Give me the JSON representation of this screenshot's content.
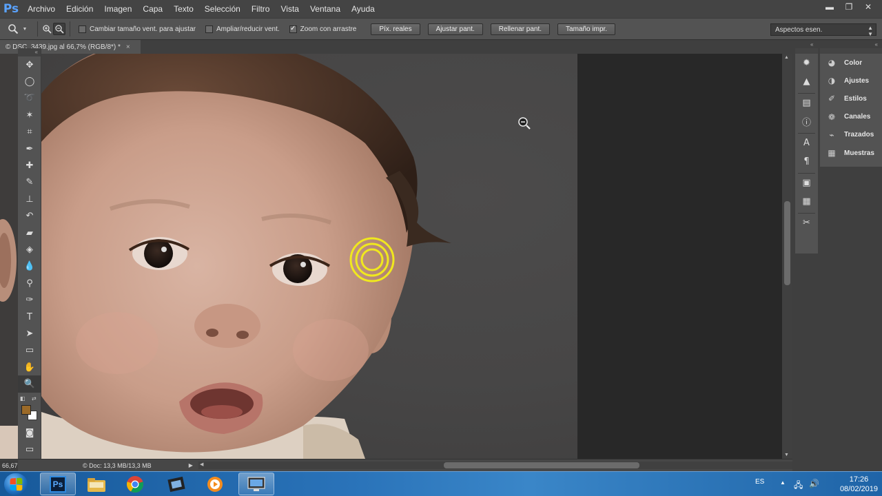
{
  "app": {
    "logo": "Ps"
  },
  "menu": [
    "Archivo",
    "Edición",
    "Imagen",
    "Capa",
    "Texto",
    "Selección",
    "Filtro",
    "Vista",
    "Ventana",
    "Ayuda"
  ],
  "window_controls": {
    "minimize": "▬",
    "restore": "❐",
    "close": "✕"
  },
  "options": {
    "tool_icon": "zoom-icon",
    "resize_windows_label": "Cambiar tamaño vent. para ajustar",
    "resize_windows_checked": false,
    "zoom_all_windows_label": "Ampliar/reducir vent.",
    "zoom_all_windows_checked": false,
    "scrubby_zoom_label": "Zoom con arrastre",
    "scrubby_zoom_checked": true,
    "check_mark": "✓",
    "buttons": [
      "Píx. reales",
      "Ajustar pant.",
      "Rellenar pant.",
      "Tamaño impr."
    ],
    "workspace": "Aspectos esen."
  },
  "document": {
    "tab_label": "© DSC_3439.jpg al 66,7% (RGB/8*) *",
    "tab_close": "×",
    "zoom": "66,67",
    "doc_info": "© Doc: 13,3 MB/13,3 MB",
    "status_arrow": "▶"
  },
  "toolbar": {
    "collapse": "«",
    "tools": [
      {
        "name": "move-tool",
        "glyph": "✥"
      },
      {
        "name": "elliptical-marquee-tool",
        "glyph": "◯"
      },
      {
        "name": "lasso-tool",
        "glyph": "➰"
      },
      {
        "name": "magic-wand-tool",
        "glyph": "✶"
      },
      {
        "name": "crop-tool",
        "glyph": "⌗"
      },
      {
        "name": "eyedropper-tool",
        "glyph": "✒"
      },
      {
        "name": "healing-brush-tool",
        "glyph": "✚"
      },
      {
        "name": "brush-tool",
        "glyph": "✎"
      },
      {
        "name": "clone-stamp-tool",
        "glyph": "⊥"
      },
      {
        "name": "history-brush-tool",
        "glyph": "↶"
      },
      {
        "name": "eraser-tool",
        "glyph": "▰"
      },
      {
        "name": "paint-bucket-tool",
        "glyph": "◈"
      },
      {
        "name": "blur-tool",
        "glyph": "💧"
      },
      {
        "name": "dodge-tool",
        "glyph": "⚲"
      },
      {
        "name": "pen-tool",
        "glyph": "✑"
      },
      {
        "name": "type-tool",
        "glyph": "T"
      },
      {
        "name": "path-selection-tool",
        "glyph": "➤"
      },
      {
        "name": "rectangle-tool",
        "glyph": "▭"
      },
      {
        "name": "hand-tool",
        "glyph": "✋"
      },
      {
        "name": "zoom-tool",
        "glyph": "🔍"
      }
    ],
    "selected": "zoom-tool",
    "foreground_color": "#9b6a28",
    "background_color": "#ffffff"
  },
  "panels": {
    "collapse": "«",
    "icons": [
      "navigator-icon",
      "histogram-icon",
      "layer-comps-icon",
      "info-icon",
      "character-icon",
      "paragraph-icon",
      "history-icon",
      "actions-icon",
      "tool-presets-icon"
    ],
    "items": [
      {
        "label": "Color",
        "icon": "color-palette-icon"
      },
      {
        "label": "Ajustes",
        "icon": "adjustments-icon"
      },
      {
        "label": "Estilos",
        "icon": "styles-icon"
      },
      {
        "label": "Canales",
        "icon": "channels-icon"
      },
      {
        "label": "Trazados",
        "icon": "paths-icon"
      },
      {
        "label": "Muestras",
        "icon": "swatches-icon"
      }
    ]
  },
  "taskbar": {
    "apps": [
      "photoshop-taskbar-icon",
      "file-explorer-taskbar-icon",
      "chrome-taskbar-icon",
      "movie-maker-taskbar-icon",
      "media-player-taskbar-icon",
      "screen-recorder-taskbar-icon"
    ],
    "ps_label": "Ps",
    "language": "ES",
    "time": "17:26",
    "date": "08/02/2019"
  }
}
